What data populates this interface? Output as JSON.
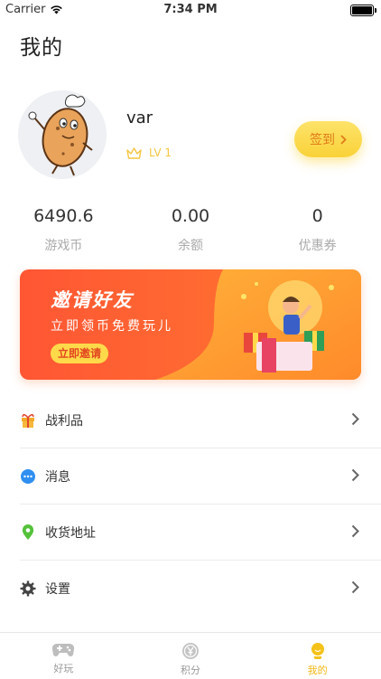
{
  "status_bar": {
    "carrier": "Carrier",
    "time": "7:34 PM"
  },
  "page": {
    "title": "我的"
  },
  "profile": {
    "username": "var",
    "level": "LV 1",
    "signin_label": "签到"
  },
  "stats": [
    {
      "value": "6490.6",
      "label": "游戏币"
    },
    {
      "value": "0.00",
      "label": "余额"
    },
    {
      "value": "0",
      "label": "优惠券"
    }
  ],
  "banner": {
    "title": "邀请好友",
    "subtitle": "立即领币免费玩儿",
    "button": "立即邀请"
  },
  "menu": [
    {
      "label": "战利品",
      "icon": "gift-icon"
    },
    {
      "label": "消息",
      "icon": "message-icon"
    },
    {
      "label": "收货地址",
      "icon": "location-icon"
    },
    {
      "label": "设置",
      "icon": "gear-icon"
    }
  ],
  "tabs": [
    {
      "label": "好玩",
      "icon": "gamepad-icon",
      "active": false
    },
    {
      "label": "积分",
      "icon": "points-icon",
      "active": false
    },
    {
      "label": "我的",
      "icon": "profile-icon",
      "active": true
    }
  ],
  "colors": {
    "accent": "#f2b712",
    "signin_bg": "#fad238",
    "banner_start": "#ff5a36",
    "banner_end": "#ff9a2e"
  }
}
